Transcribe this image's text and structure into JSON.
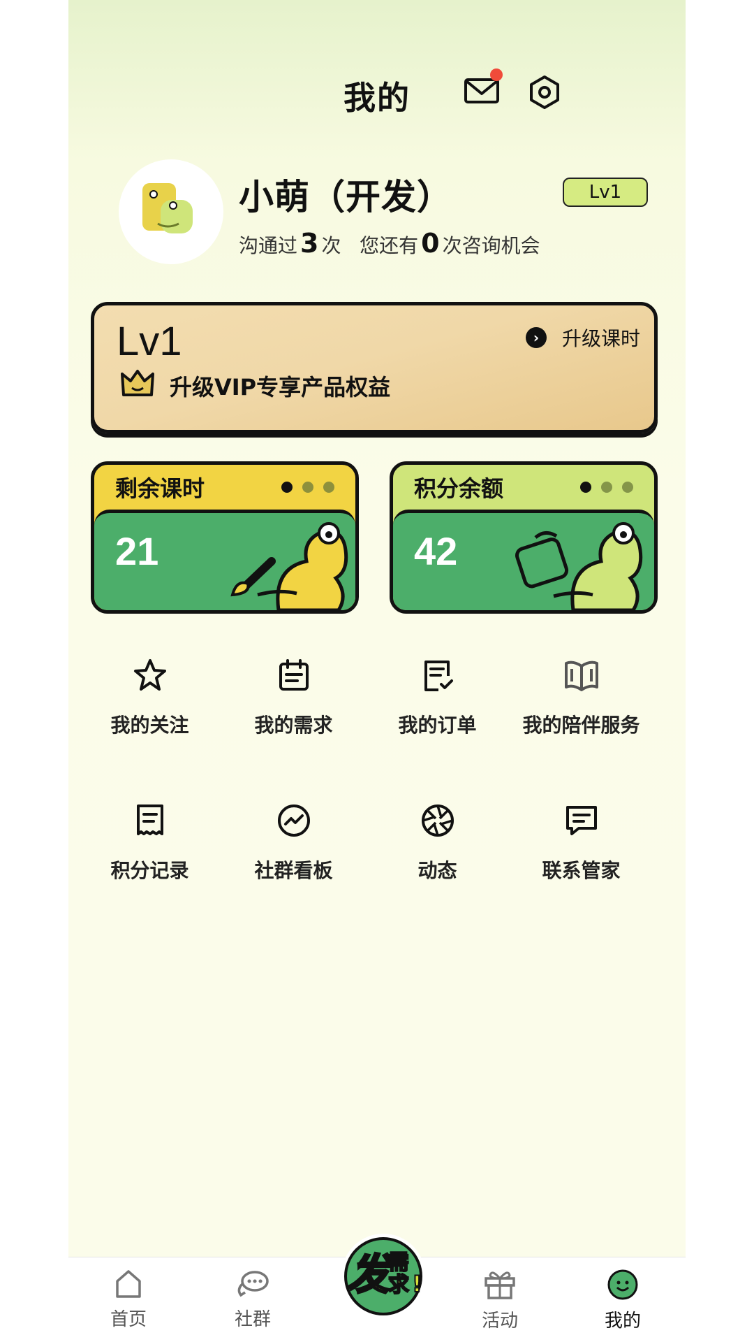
{
  "header": {
    "title": "我的",
    "mail_icon": "mail-icon",
    "settings_icon": "settings-hexagon-icon",
    "has_notification": true
  },
  "profile": {
    "name": "小萌（开发）",
    "level_badge": "Lv1",
    "stats_prefix": "沟通过",
    "contact_count": "3",
    "stats_mid": "次   您还有",
    "remaining_count": "0",
    "stats_suffix": "次咨询机会"
  },
  "vip": {
    "level": "Lv1",
    "upgrade_label": "升级课时",
    "benefit_text": "升级VIP专享产品权益"
  },
  "cards": [
    {
      "title": "剩余课时",
      "value": "21",
      "head_color": "#f2d443",
      "body_color": "#4cae6a"
    },
    {
      "title": "积分余额",
      "value": "42",
      "head_color": "#cfe57a",
      "body_color": "#4cae6a"
    }
  ],
  "menu": [
    {
      "label": "我的关注",
      "icon": "star-icon"
    },
    {
      "label": "我的需求",
      "icon": "calendar-note-icon"
    },
    {
      "label": "我的订单",
      "icon": "order-check-icon"
    },
    {
      "label": "我的陪伴服务",
      "icon": "book-open-icon"
    },
    {
      "label": "积分记录",
      "icon": "receipt-icon"
    },
    {
      "label": "社群看板",
      "icon": "trend-circle-icon"
    },
    {
      "label": "动态",
      "icon": "aperture-icon"
    },
    {
      "label": "联系管家",
      "icon": "chat-bubble-icon"
    }
  ],
  "tabbar": {
    "items": [
      {
        "label": "首页",
        "icon": "home-icon"
      },
      {
        "label": "社群",
        "icon": "community-chat-icon"
      },
      {
        "label": "活动",
        "icon": "gift-icon"
      },
      {
        "label": "我的",
        "icon": "profile-smile-icon",
        "active": true
      }
    ],
    "center_button": {
      "text_big": "发",
      "text_small_1": "需",
      "text_small_2": "求"
    }
  },
  "colors": {
    "accent_green": "#4cae6a",
    "badge_lime": "#d6eb82",
    "notification_red": "#f04b3a"
  }
}
